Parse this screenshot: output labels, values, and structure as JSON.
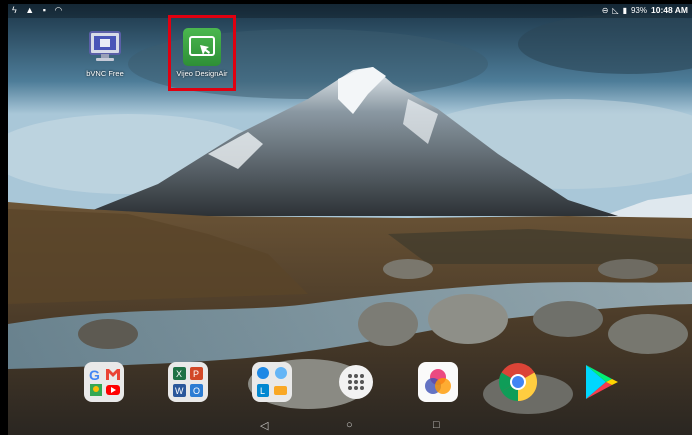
{
  "status_bar": {
    "left_icons": [
      "usb-icon",
      "warning-icon",
      "image-icon",
      "wifi-off-icon"
    ],
    "right_icons": [
      "dnd-icon",
      "signal-icon",
      "battery-icon"
    ],
    "battery": "93%",
    "time": "10:48 AM"
  },
  "desktop_icons": [
    {
      "label": "bVNC Free",
      "icon": "vnc-monitor-icon"
    },
    {
      "label": "Vijeo DesignAir",
      "icon": "vijeo-designair-icon"
    }
  ],
  "dock_icons": [
    "google-apps-folder-icon",
    "office-apps-folder-icon",
    "tools-folder-icon",
    "app-drawer-icon",
    "photos-icon",
    "chrome-icon",
    "play-store-icon"
  ],
  "nav": {
    "back": "◁",
    "home": "○",
    "recents": "□"
  },
  "colors": {
    "highlight": "#e00010"
  }
}
